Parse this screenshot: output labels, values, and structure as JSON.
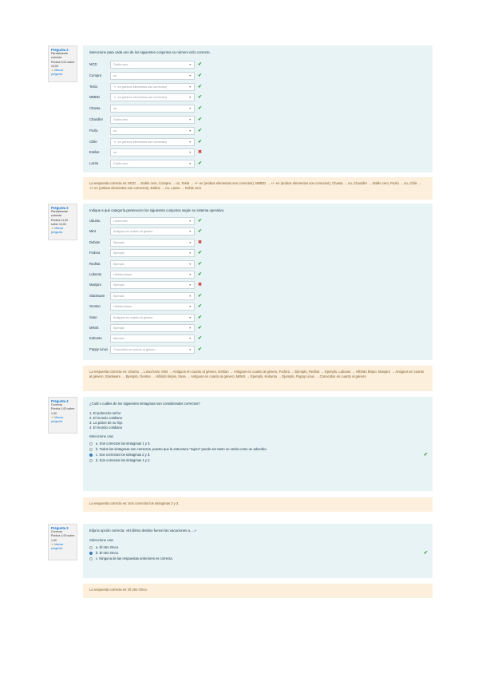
{
  "q1": {
    "info": {
      "number": "Pregunta 3",
      "state": "Parcialmente correcta",
      "score": "Puntúa 9,00 sobre 10,00",
      "flag": "Marcar pregunta"
    },
    "text": "Seleccione para cada uno de los siguientes conjuntos su número ciclo correcto.",
    "rows": [
      {
        "label": "MCD",
        "value": "Doble cero",
        "mark": "ok"
      },
      {
        "label": "Compra",
        "value": "no",
        "mark": "ok"
      },
      {
        "label": "Tesla",
        "value": "+/- en (ambos elementos son correctos)",
        "mark": "ok"
      },
      {
        "label": "MMDD",
        "value": "+/- en (ambos elementos son correctos)",
        "mark": "ok"
      },
      {
        "label": "Chanta",
        "value": "no",
        "mark": "ok"
      },
      {
        "label": "Chandler",
        "value": "Doble cero",
        "mark": "ok"
      },
      {
        "label": "Puzla",
        "value": "no",
        "mark": "ok"
      },
      {
        "label": "Chile",
        "value": "+/- en (ambos elementos son correctos)",
        "mark": "ok"
      },
      {
        "label": "Estilos",
        "value": "no",
        "mark": "bad"
      },
      {
        "label": "Lazos",
        "value": "Doble cero",
        "mark": "ok"
      }
    ],
    "feedback": "La respuesta correcta es: MCD → Doble cero, Compra → no, Tesla → +/- en (ambos elementos son correctos), MMDD → +/- en (ambos elementos son correctos), Chanta → no, Chandler → Doble cero, Puzla → no, Chile → +/- en (ambos elementos son correctos), Estilos → no, Lazos → Doble cero"
  },
  "q2": {
    "info": {
      "number": "Pregunta 2",
      "state": "Parcialmente correcta",
      "score": "Puntúa 11,00 sobre 13,00",
      "flag": "Marcar pregunta"
    },
    "text": "Indique a qué categoría pertenecen los siguientes conjuntos según su sistema operativo.",
    "rows": [
      {
        "label": "Ubuntu",
        "value": "Linux/Unix",
        "mark": "ok"
      },
      {
        "label": "Mint",
        "value": "Antiguos en cuanto al género",
        "mark": "ok"
      },
      {
        "label": "Debian",
        "value": "Ejemplo",
        "mark": "bad"
      },
      {
        "label": "Fedora",
        "value": "Ejemplo",
        "mark": "ok"
      },
      {
        "label": "Redhat",
        "value": "Ejemplo",
        "mark": "ok"
      },
      {
        "label": "Lubuntu",
        "value": "Híbrido limpio",
        "mark": "ok"
      },
      {
        "label": "Manjaro",
        "value": "Ejemplo",
        "mark": "bad"
      },
      {
        "label": "Slackware",
        "value": "Ejemplo",
        "mark": "ok"
      },
      {
        "label": "Gentoo",
        "value": "Híbrido limpio",
        "mark": "ok"
      },
      {
        "label": "Suse",
        "value": "Antiguos en cuanto al género",
        "mark": "ok"
      },
      {
        "label": "MINIX",
        "value": "Ejemplo",
        "mark": "ok"
      },
      {
        "label": "Kubuntu",
        "value": "Ejemplo",
        "mark": "ok"
      },
      {
        "label": "Puppy Linux",
        "value": "Conocidos en cuanto al género",
        "mark": "ok"
      }
    ],
    "feedback": "La respuesta correcta es: Ubuntu → Linux/Unix, Mint → Antiguos en cuanto al género, Debian → Antiguos en cuanto al género, Fedora → Ejemplo, Redhat → Ejemplo, Lubuntu → Híbrido limpio, Manjaro → Antiguos en cuanto al género, Slackware → Ejemplo, Gentoo → Híbrido limpio, Suse → Antiguos en cuanto al género, MINIX → Ejemplo, Kubuntu → Ejemplo, Puppy Linux → Conocidos en cuanto al género"
  },
  "q3": {
    "info": {
      "number": "Pregunta 4",
      "state": "Correcta",
      "score": "Puntúa 1,00 sobre 1,00",
      "flag": "Marcar pregunta"
    },
    "text": "¿Cuál o cuáles de los siguientes sintagmas son considerados correctos?",
    "items": [
      "1. El pobrecito señor",
      "2. El mundo cotidiano",
      "3. La pobre de su hijo",
      "4. El mundo cotidiano"
    ],
    "select_label": "Seleccione una:",
    "options": [
      {
        "text": "a. Son correctos los sintagmas 1 y 3.",
        "selected": false,
        "mark": ""
      },
      {
        "text": "b. Todos los sintagmas son correctos, puesto que la estructura \"sujeto\" puede ser tanto un verbo como un adverbio.",
        "selected": false,
        "mark": ""
      },
      {
        "text": "c. Son correctos los sintagmas 2 y 3.",
        "selected": true,
        "mark": "ok"
      },
      {
        "text": "d. Son correctos los sintagmas 1 y 2.",
        "selected": false,
        "mark": ""
      }
    ],
    "feedback": "La respuesta correcta es: Son correctos los sintagmas 2 y 3."
  },
  "q4": {
    "info": {
      "number": "Pregunta 3",
      "state": "Correcta",
      "score": "Puntúa 1,00 sobre 1,00",
      "flag": "Marcar pregunta"
    },
    "text": "Elija la opción correcta: «El último destino fueron las vacaciones a….»",
    "select_label": "Seleccione una:",
    "options": [
      {
        "text": "a. El otro Onco.",
        "selected": false,
        "mark": ""
      },
      {
        "text": "b. El otro Onco.",
        "selected": true,
        "mark": "ok"
      },
      {
        "text": "c. Ninguna de las respuestas anteriores es correcta.",
        "selected": false,
        "mark": ""
      }
    ],
    "feedback": "La respuesta correcta es: El otro Onco."
  }
}
